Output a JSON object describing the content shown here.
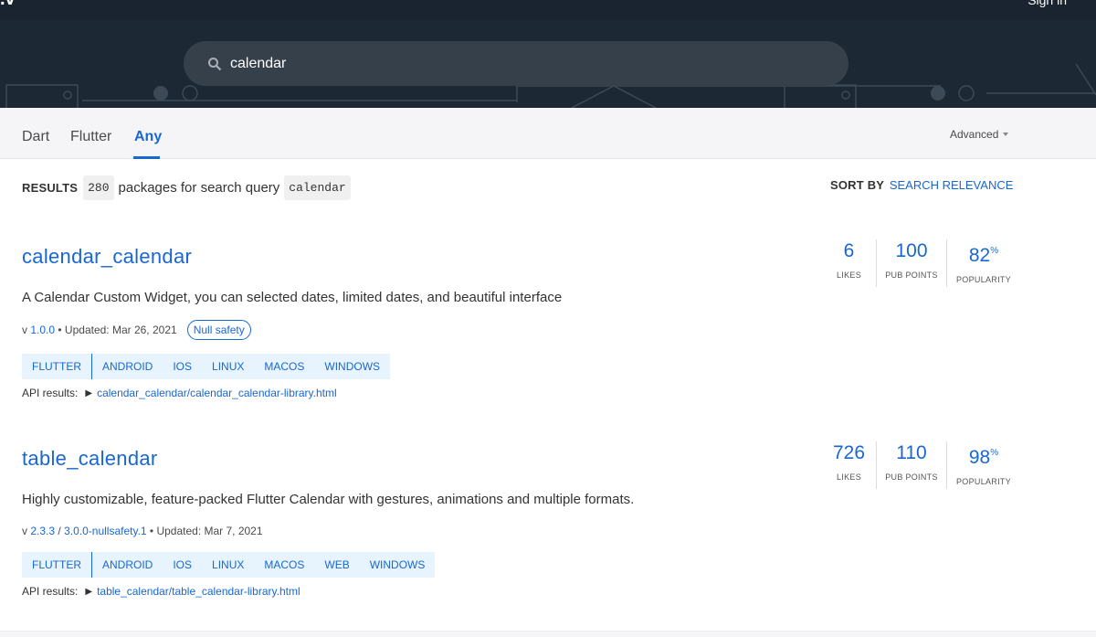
{
  "header": {
    "logo_fragment": ".v",
    "signin_label": "Sign in"
  },
  "search": {
    "value": "calendar",
    "icon": "search-icon"
  },
  "tabs": [
    {
      "label": "Dart"
    },
    {
      "label": "Flutter"
    },
    {
      "label": "Any"
    }
  ],
  "active_tab": "Any",
  "advanced_label": "Advanced",
  "results": {
    "label": "RESULTS",
    "count": "280",
    "text": "packages for search query",
    "query": "calendar"
  },
  "sort": {
    "label": "SORT BY",
    "value": "SEARCH RELEVANCE"
  },
  "packages": [
    {
      "name": "calendar_calendar",
      "description": "A Calendar Custom Widget, you can selected dates, limited dates, and beautiful interface",
      "version_prefix": "v",
      "version": "1.0.0",
      "updated": "• Updated: Mar 26, 2021",
      "badge": "Null safety",
      "tags": [
        "FLUTTER",
        "ANDROID",
        "IOS",
        "LINUX",
        "MACOS",
        "WINDOWS"
      ],
      "api_label": "API results:",
      "api_link": "calendar_calendar/calendar_calendar-library.html",
      "likes": "6",
      "likes_label": "LIKES",
      "pub_points": "100",
      "pub_points_label": "PUB POINTS",
      "popularity": "82",
      "popularity_unit": "%",
      "popularity_label": "POPULARITY"
    },
    {
      "name": "table_calendar",
      "description": "Highly customizable, feature-packed Flutter Calendar with gestures, animations and multiple formats.",
      "version_prefix": "v",
      "version": "2.3.3",
      "version_sep": "/",
      "version2": "3.0.0-nullsafety.1",
      "updated": "• Updated: Mar 7, 2021",
      "tags": [
        "FLUTTER",
        "ANDROID",
        "IOS",
        "LINUX",
        "MACOS",
        "WEB",
        "WINDOWS"
      ],
      "api_label": "API results:",
      "api_link": "table_calendar/table_calendar-library.html",
      "likes": "726",
      "likes_label": "LIKES",
      "pub_points": "110",
      "pub_points_label": "PUB POINTS",
      "popularity": "98",
      "popularity_unit": "%",
      "popularity_label": "POPULARITY"
    }
  ],
  "colors": {
    "banner": "#1c2834",
    "accent": "#1967d2",
    "tag_bg": "#e7f4fd"
  }
}
